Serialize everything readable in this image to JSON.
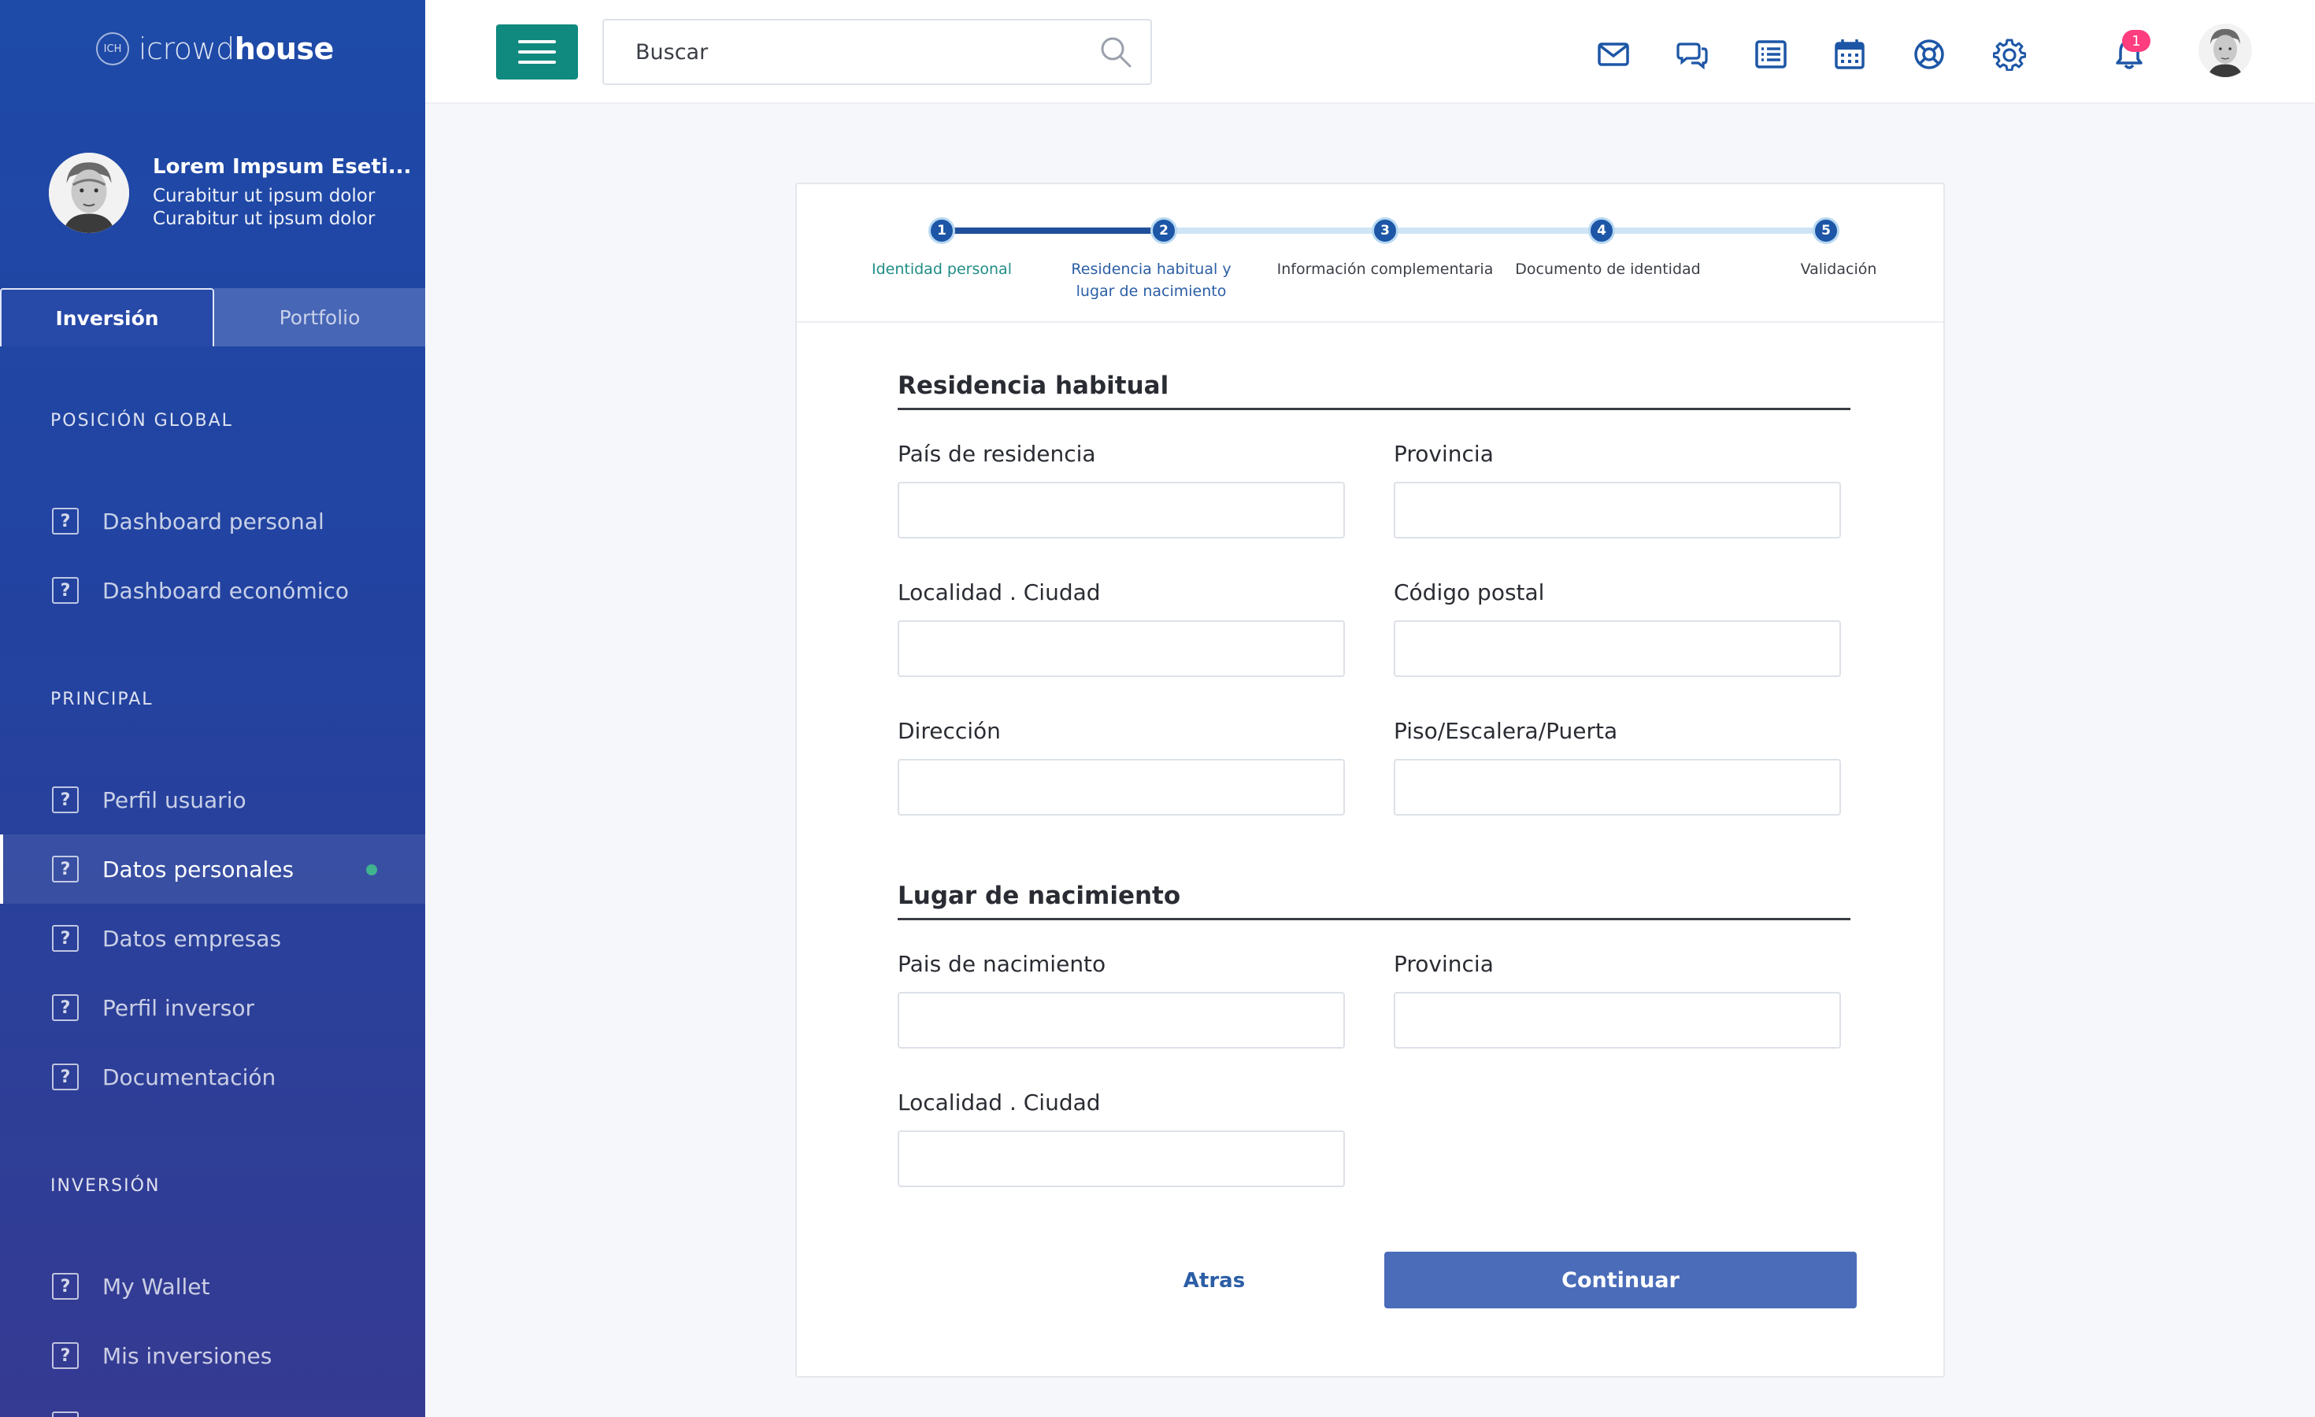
{
  "brand": {
    "badge": "ICH",
    "name_light": "icrowd",
    "name_bold": "house"
  },
  "profile": {
    "name": "Lorem Impsum Eseti...",
    "line1": "Curabitur ut ipsum dolor",
    "line2": "Curabitur ut ipsum dolor"
  },
  "sidebar_tabs": [
    "Inversión",
    "Portfolio"
  ],
  "sections": {
    "global": {
      "title": "POSICIÓN GLOBAL",
      "items": [
        "Dashboard personal",
        "Dashboard económico"
      ]
    },
    "principal": {
      "title": "PRINCIPAL",
      "items": [
        "Perfil usuario",
        "Datos personales",
        "Datos empresas",
        "Perfil inversor",
        "Documentación"
      ],
      "active_index": 1
    },
    "inversion": {
      "title": "INVERSIÓN",
      "items": [
        "My Wallet",
        "Mis inversiones"
      ]
    }
  },
  "nav_icon_glyph": "?",
  "topbar": {
    "search_placeholder": "Buscar",
    "icons": [
      "mail-icon",
      "chat-icon",
      "list-icon",
      "calendar-icon",
      "support-icon",
      "gear-icon",
      "bell-icon"
    ],
    "notification_count": "1"
  },
  "stepper": {
    "steps": [
      {
        "number": "1",
        "label": "Identidad personal"
      },
      {
        "number": "2",
        "label": "Residencia habitual y lugar de nacimiento"
      },
      {
        "number": "3",
        "label": "Información complementaria"
      },
      {
        "number": "4",
        "label": "Documento de identidad"
      },
      {
        "number": "5",
        "label": "Validación"
      }
    ],
    "current_step": 2
  },
  "form": {
    "residencia": {
      "title": "Residencia habitual",
      "fields": {
        "pais": {
          "label": "País de residencia",
          "value": ""
        },
        "provincia": {
          "label": "Provincia",
          "value": ""
        },
        "localidad": {
          "label": "Localidad . Ciudad",
          "value": ""
        },
        "codigo_postal": {
          "label": "Código postal",
          "value": ""
        },
        "direccion": {
          "label": "Dirección",
          "value": ""
        },
        "piso": {
          "label": "Piso/Escalera/Puerta",
          "value": ""
        }
      }
    },
    "nacimiento": {
      "title": "Lugar de nacimiento",
      "fields": {
        "pais": {
          "label": "Pais de nacimiento",
          "value": ""
        },
        "provincia": {
          "label": "Provincia",
          "value": ""
        },
        "localidad": {
          "label": "Localidad . Ciudad",
          "value": ""
        }
      }
    }
  },
  "actions": {
    "back": "Atras",
    "continue": "Continuar"
  },
  "colors": {
    "sidebar": "#2342a0",
    "menu_button": "#10897f",
    "icon_blue": "#1d56a6",
    "badge": "#ff3d7f",
    "continue_button": "#4a6cb9",
    "active_dot": "#3fb38e"
  }
}
